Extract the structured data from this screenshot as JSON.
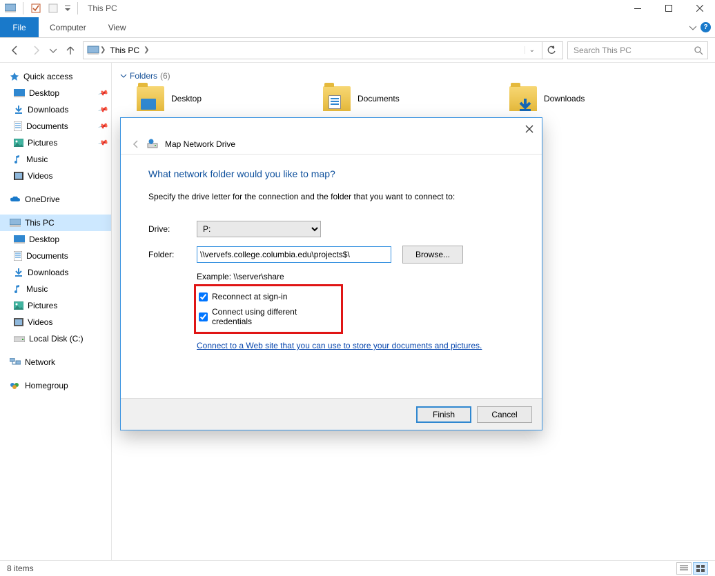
{
  "window": {
    "title": "This PC"
  },
  "ribbon": {
    "file": "File",
    "tabs": [
      "Computer",
      "View"
    ]
  },
  "nav": {
    "breadcrumb": [
      "This PC"
    ],
    "search_placeholder": "Search This PC"
  },
  "tree": {
    "quick_access": "Quick access",
    "quick_items": [
      "Desktop",
      "Downloads",
      "Documents",
      "Pictures",
      "Music",
      "Videos"
    ],
    "onedrive": "OneDrive",
    "this_pc": "This PC",
    "this_pc_items": [
      "Desktop",
      "Documents",
      "Downloads",
      "Music",
      "Pictures",
      "Videos",
      "Local Disk (C:)"
    ],
    "network": "Network",
    "homegroup": "Homegroup"
  },
  "content": {
    "group_label": "Folders",
    "group_count": "(6)",
    "tiles": [
      "Desktop",
      "Documents",
      "Downloads"
    ]
  },
  "dialog": {
    "window_title": "Map Network Drive",
    "heading": "What network folder would you like to map?",
    "subtext": "Specify the drive letter for the connection and the folder that you want to connect to:",
    "drive_label": "Drive:",
    "drive_value": "P:",
    "folder_label": "Folder:",
    "folder_value": "\\\\vervefs.college.columbia.edu\\projects$\\",
    "browse": "Browse...",
    "example": "Example: \\\\server\\share",
    "reconnect": "Reconnect at sign-in",
    "diff_creds": "Connect using different credentials",
    "link_text": "Connect to a Web site that you can use to store your documents and pictures",
    "finish": "Finish",
    "cancel": "Cancel"
  },
  "statusbar": {
    "items": "8 items"
  }
}
